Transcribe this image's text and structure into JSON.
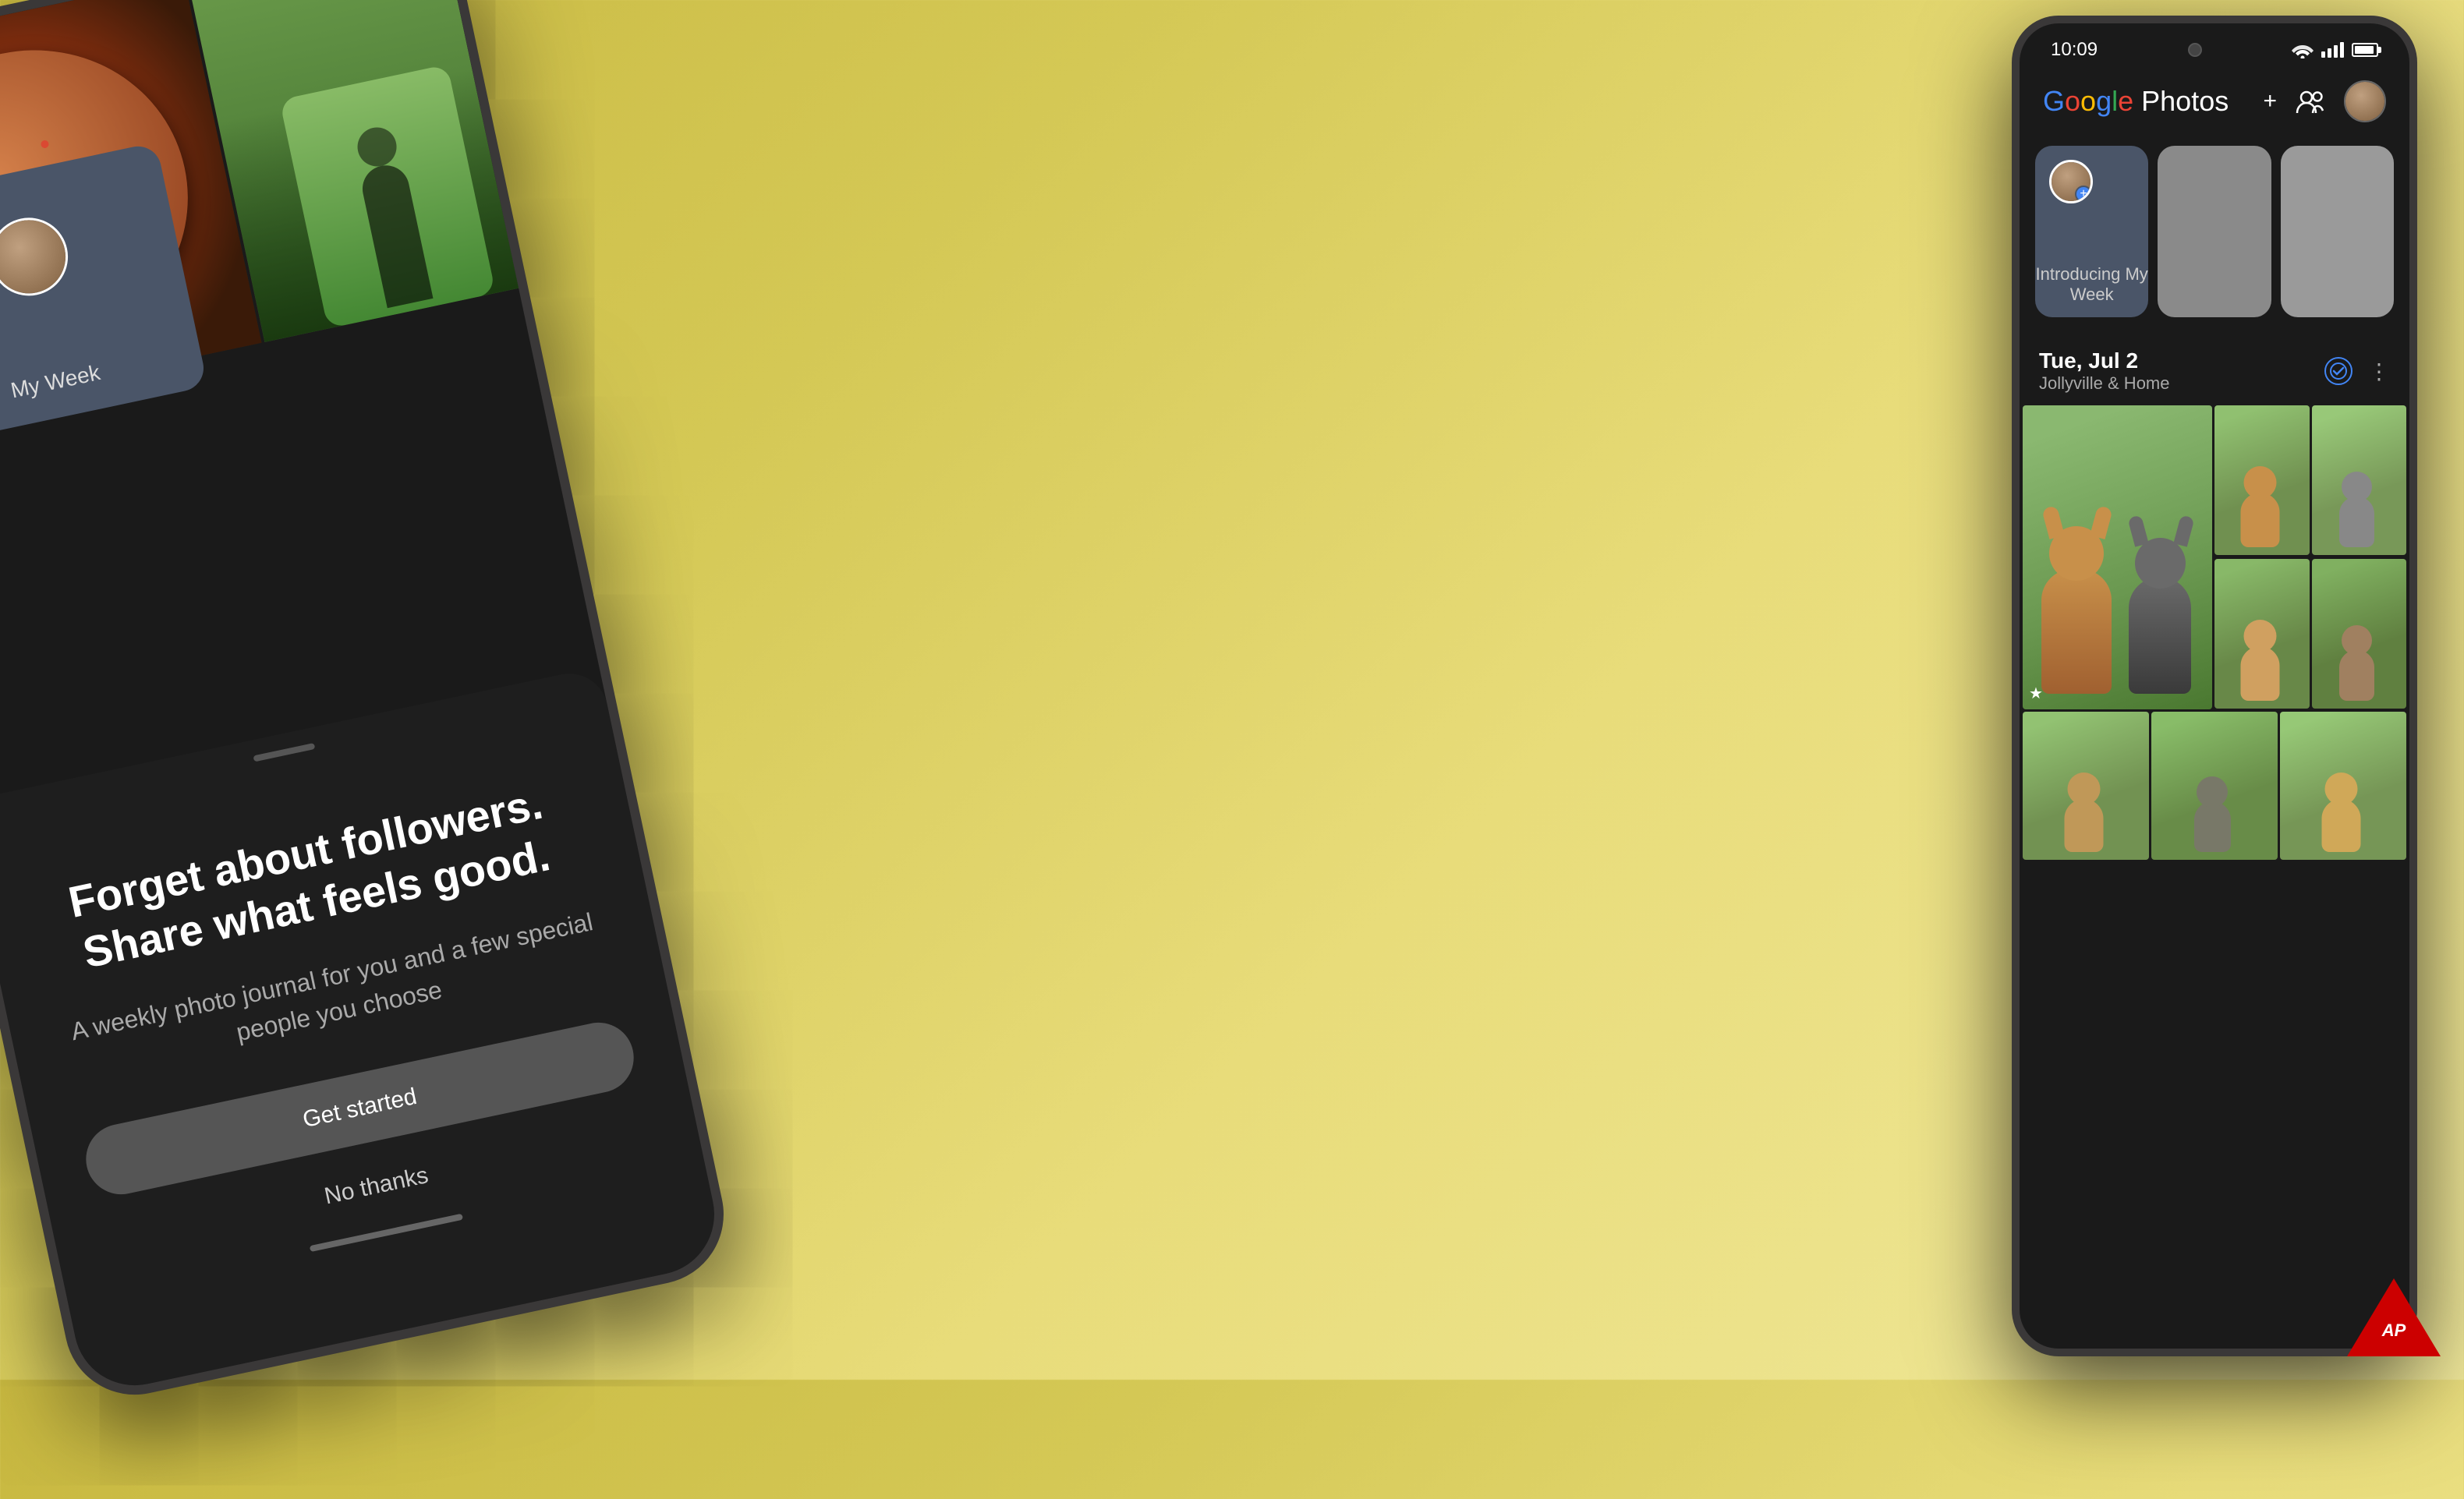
{
  "background": {
    "gradient_start": "#c8b840",
    "gradient_end": "#f0e89a"
  },
  "left_phone": {
    "my_week_label": "My Week",
    "bottom_sheet": {
      "title": "Forget about followers. Share what feels good.",
      "subtitle": "A weekly photo journal for you and a few special people you choose",
      "get_started": "Get started",
      "no_thanks": "No thanks"
    }
  },
  "right_phone": {
    "status_bar": {
      "time": "10:09"
    },
    "header": {
      "google_text": "Google",
      "photos_text": " Photos"
    },
    "story_cards": [
      {
        "label": "Introducing My Week",
        "type": "main"
      },
      {
        "label": "",
        "type": "gray1"
      },
      {
        "label": "",
        "type": "gray2"
      }
    ],
    "date_section": {
      "date": "Tue, Jul 2",
      "location": "Jollyville & Home"
    },
    "icons": {
      "plus": "+",
      "people": "👥",
      "check": "✓",
      "more": "⋮",
      "star": "★",
      "wifi": "▲",
      "signal": "|||",
      "battery": "▉"
    }
  },
  "watermark": {
    "text": "AP"
  }
}
